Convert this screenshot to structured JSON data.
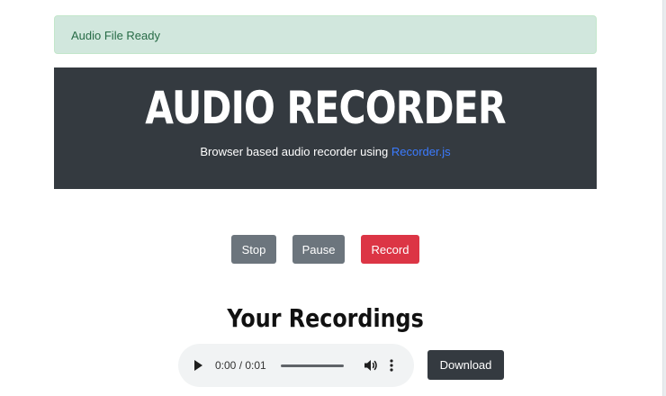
{
  "alert": {
    "text": "Audio File Ready"
  },
  "hero": {
    "title": "AUDIO RECORDER",
    "subtitle_prefix": "Browser based audio recorder using ",
    "link_text": "Recorder.js"
  },
  "controls": {
    "stop_label": "Stop",
    "pause_label": "Pause",
    "record_label": "Record"
  },
  "recordings": {
    "title": "Your Recordings",
    "player": {
      "time": "0:00 / 0:01",
      "icons": [
        "play-icon",
        "volume-icon",
        "more-vert-icon"
      ]
    },
    "download_label": "Download"
  },
  "colors": {
    "alert_bg": "#d1e7dd",
    "hero_bg": "#343a40",
    "secondary": "#6c757d",
    "danger": "#dc3545",
    "link": "#3b7bff",
    "dark_button": "#343a40"
  }
}
